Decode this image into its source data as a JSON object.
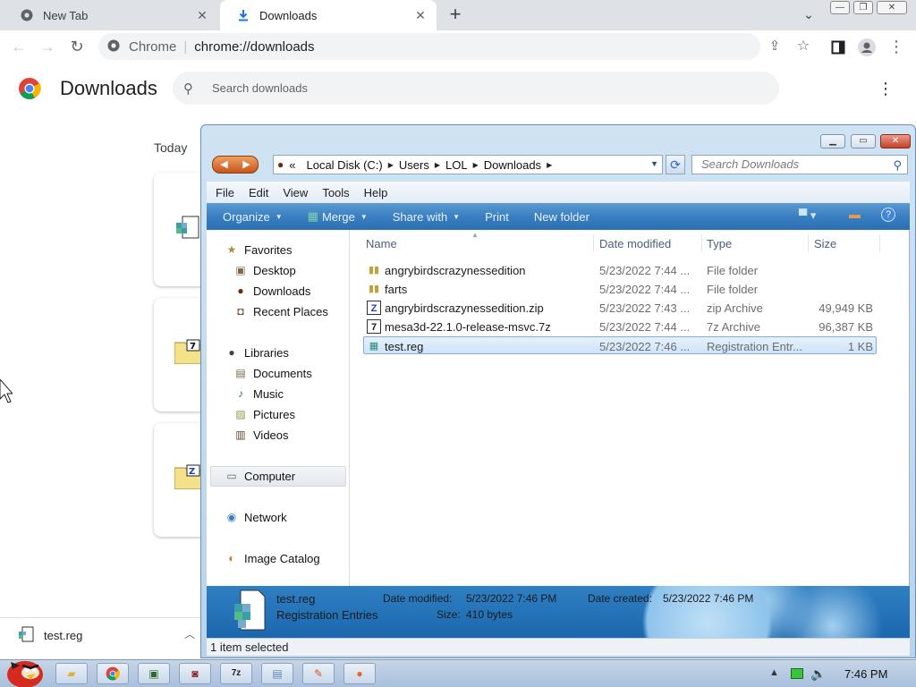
{
  "browser": {
    "tabs": [
      {
        "label": "New Tab",
        "icon": "chrome-icon"
      },
      {
        "label": "Downloads",
        "icon": "download-icon"
      }
    ],
    "omnibox": {
      "site": "Chrome",
      "url": "chrome://downloads"
    }
  },
  "downloads_page": {
    "title": "Downloads",
    "search_placeholder": "Search downloads",
    "group_label": "Today",
    "shelf_item": "test.reg"
  },
  "explorer": {
    "address": {
      "prefix": "«",
      "crumbs": [
        "Local Disk (C:)",
        "Users",
        "LOL",
        "Downloads"
      ]
    },
    "search_placeholder": "Search Downloads",
    "menu": [
      "File",
      "Edit",
      "View",
      "Tools",
      "Help"
    ],
    "commands": [
      "Organize",
      "Merge",
      "Share with",
      "Print",
      "New folder"
    ],
    "nav": {
      "favorites": "Favorites",
      "favorites_items": [
        "Desktop",
        "Downloads",
        "Recent Places"
      ],
      "libraries": "Libraries",
      "libraries_items": [
        "Documents",
        "Music",
        "Pictures",
        "Videos"
      ],
      "computer": "Computer",
      "network": "Network",
      "image_catalog": "Image Catalog"
    },
    "columns": [
      "Name",
      "Date modified",
      "Type",
      "Size"
    ],
    "files": [
      {
        "name": "angrybirdscrazynessedition",
        "date": "5/23/2022 7:44 ...",
        "type": "File folder",
        "size": ""
      },
      {
        "name": "farts",
        "date": "5/23/2022 7:44 ...",
        "type": "File folder",
        "size": ""
      },
      {
        "name": "angrybirdscrazynessedition.zip",
        "date": "5/23/2022 7:43 ...",
        "type": "zip Archive",
        "size": "49,949 KB"
      },
      {
        "name": "mesa3d-22.1.0-release-msvc.7z",
        "date": "5/23/2022 7:44 ...",
        "type": "7z Archive",
        "size": "96,387 KB"
      },
      {
        "name": "test.reg",
        "date": "5/23/2022 7:46 ...",
        "type": "Registration Entr...",
        "size": "1 KB"
      }
    ],
    "details": {
      "name": "test.reg",
      "kind": "Registration Entries",
      "modified_label": "Date modified:",
      "modified_value": "5/23/2022 7:46 PM",
      "created_label": "Date created:",
      "created_value": "5/23/2022 7:46 PM",
      "size_label": "Size:",
      "size_value": "410 bytes"
    },
    "status": "1 item selected"
  },
  "taskbar": {
    "time": "7:46 PM"
  }
}
